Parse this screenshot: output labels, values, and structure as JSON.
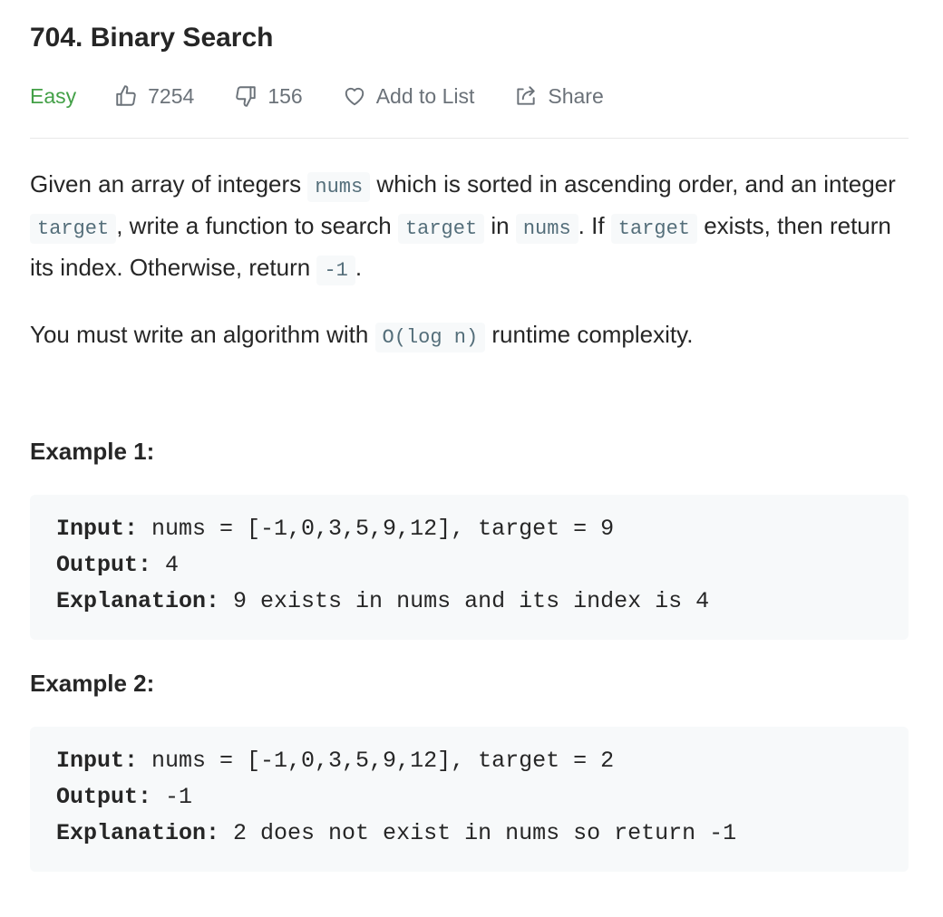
{
  "problem": {
    "title": "704. Binary Search",
    "difficulty": "Easy",
    "likes": "7254",
    "dislikes": "156",
    "add_to_list": "Add to List",
    "share": "Share"
  },
  "description": {
    "p1": {
      "t1": "Given an array of integers ",
      "c1": "nums",
      "t2": " which is sorted in ascending order, and an integer ",
      "c2": "target",
      "t3": ", write a function to search ",
      "c3": "target",
      "t4": " in ",
      "c4": "nums",
      "t5": ". If ",
      "c5": "target",
      "t6": " exists, then return its index. Otherwise, return ",
      "c6": "-1",
      "t7": "."
    },
    "p2": {
      "t1": "You must write an algorithm with ",
      "c1": "O(log n)",
      "t2": " runtime complexity."
    }
  },
  "examples": [
    {
      "title": "Example 1:",
      "input_label": "Input:",
      "input_value": " nums = [-1,0,3,5,9,12], target = 9",
      "output_label": "Output:",
      "output_value": " 4",
      "explanation_label": "Explanation:",
      "explanation_value": " 9 exists in nums and its index is 4"
    },
    {
      "title": "Example 2:",
      "input_label": "Input:",
      "input_value": " nums = [-1,0,3,5,9,12], target = 2",
      "output_label": "Output:",
      "output_value": " -1",
      "explanation_label": "Explanation:",
      "explanation_value": " 2 does not exist in nums so return -1"
    }
  ],
  "colors": {
    "easy": "#43a047",
    "meta_text": "#6b7279",
    "code_bg": "#f7f9fa",
    "inline_code_text": "#546e7a"
  },
  "icons": {
    "like": "thumbs-up-icon",
    "dislike": "thumbs-down-icon",
    "add_to_list": "heart-icon",
    "share": "share-icon"
  }
}
